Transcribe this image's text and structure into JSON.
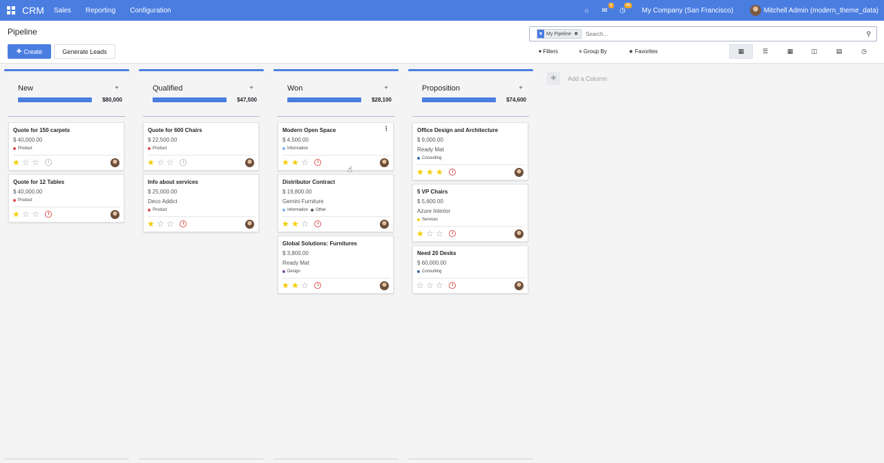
{
  "navbar": {
    "brand": "CRM",
    "menus": [
      "Sales",
      "Reporting",
      "Configuration"
    ],
    "messages_badge": "5",
    "activities_badge": "48",
    "company": "My Company (San Francisco)",
    "user": "Mitchell Admin (modern_theme_data)"
  },
  "control": {
    "title": "Pipeline",
    "create_label": "Create",
    "generate_label": "Generate Leads",
    "facet_label": "My Pipeline",
    "search_placeholder": "Search...",
    "filters_label": "Filters",
    "groupby_label": "Group By",
    "favorites_label": "Favorites"
  },
  "kanban": {
    "add_column_label": "Add a Column",
    "columns": [
      {
        "title": "New",
        "total": "$80,000",
        "progress": 1.0,
        "cards": [
          {
            "title": "Quote for 150 carpets",
            "amount": "$ 40,000.00",
            "company": "",
            "tags": [
              {
                "label": "Product",
                "color": "#e04a4a"
              }
            ],
            "stars": 1,
            "activity": "none"
          },
          {
            "title": "Quote for 12 Tables",
            "amount": "$ 40,000.00",
            "company": "",
            "tags": [
              {
                "label": "Product",
                "color": "#e04a4a"
              }
            ],
            "stars": 1,
            "activity": "overdue"
          }
        ]
      },
      {
        "title": "Qualified",
        "total": "$47,500",
        "progress": 1.0,
        "cards": [
          {
            "title": "Quote for 600 Chairs",
            "amount": "$ 22,500.00",
            "company": "",
            "tags": [
              {
                "label": "Product",
                "color": "#e04a4a"
              }
            ],
            "stars": 1,
            "activity": "none"
          },
          {
            "title": "Info about services",
            "amount": "$ 25,000.00",
            "company": "Deco Addict",
            "tags": [
              {
                "label": "Product",
                "color": "#e04a4a"
              }
            ],
            "stars": 1,
            "activity": "overdue"
          }
        ]
      },
      {
        "title": "Won",
        "total": "$28,100",
        "progress": 1.0,
        "cards": [
          {
            "title": "Modern Open Space",
            "amount": "$ 4,500.00",
            "company": "",
            "tags": [
              {
                "label": "Information",
                "color": "#7fb3e8"
              }
            ],
            "stars": 2,
            "activity": "overdue",
            "menu": "⋮"
          },
          {
            "title": "Distributor Contract",
            "amount": "$ 19,800.00",
            "company": "Gemini Furniture",
            "tags": [
              {
                "label": "Information",
                "color": "#7fb3e8"
              },
              {
                "label": "Other",
                "color": "#555555"
              }
            ],
            "stars": 2,
            "activity": "overdue"
          },
          {
            "title": "Global Solutions: Furnitures",
            "amount": "$ 3,800.00",
            "company": "Ready Mat",
            "tags": [
              {
                "label": "Design",
                "color": "#7a4f9e"
              }
            ],
            "stars": 2,
            "activity": "overdue"
          }
        ]
      },
      {
        "title": "Proposition",
        "total": "$74,600",
        "progress": 1.0,
        "cards": [
          {
            "title": "Office Design and Architecture",
            "amount": "$ 9,000.00",
            "company": "Ready Mat",
            "tags": [
              {
                "label": "Consulting",
                "color": "#3a6ea5"
              }
            ],
            "stars": 3,
            "activity": "overdue"
          },
          {
            "title": "5 VP Chairs",
            "amount": "$ 5,600.00",
            "company": "Azure Interior",
            "tags": [
              {
                "label": "Services",
                "color": "#f3cc00"
              }
            ],
            "stars": 1,
            "activity": "overdue"
          },
          {
            "title": "Need 20 Desks",
            "amount": "$ 60,000.00",
            "company": "",
            "tags": [
              {
                "label": "Consulting",
                "color": "#3a6ea5"
              }
            ],
            "stars": 0,
            "activity": "overdue"
          }
        ]
      }
    ]
  }
}
